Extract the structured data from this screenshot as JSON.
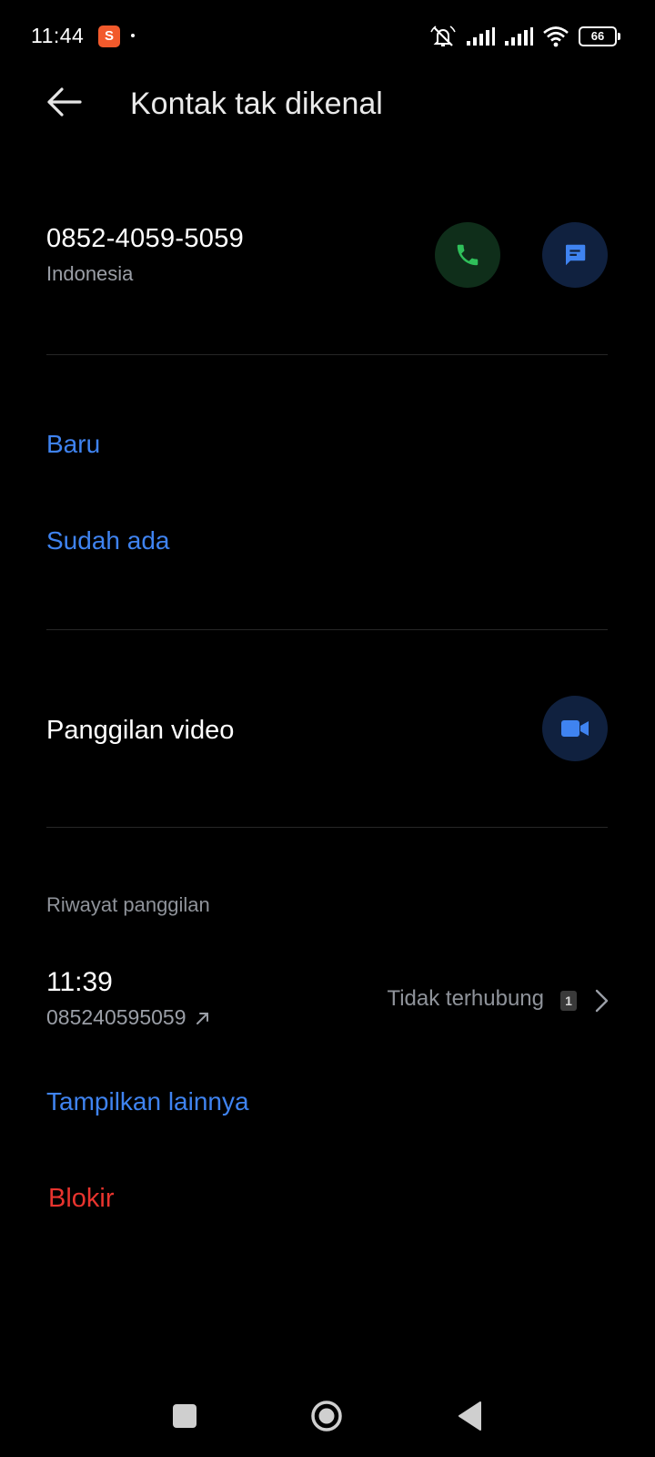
{
  "status_bar": {
    "time": "11:44",
    "shop_glyph": "S",
    "battery": "66",
    "icons": [
      "shopee-app-icon",
      "mute-icon",
      "signal-icon",
      "signal-icon",
      "wifi-icon",
      "battery-icon"
    ]
  },
  "header": {
    "title": "Kontak tak dikenal"
  },
  "contact": {
    "number": "0852-4059-5059",
    "country": "Indonesia"
  },
  "add_contact": {
    "new_label": "Baru",
    "existing_label": "Sudah ada"
  },
  "video": {
    "label": "Panggilan video"
  },
  "history": {
    "heading": "Riwayat panggilan",
    "entries": [
      {
        "time": "11:39",
        "number": "085240595059",
        "status": "Tidak terhubung",
        "count": "1"
      }
    ],
    "show_more": "Tampilkan lainnya"
  },
  "block_label": "Blokir",
  "colors": {
    "accent_blue": "#3f83f0",
    "danger_red": "#e8342e",
    "call_green": "#2fbf5a",
    "background": "#000000"
  }
}
